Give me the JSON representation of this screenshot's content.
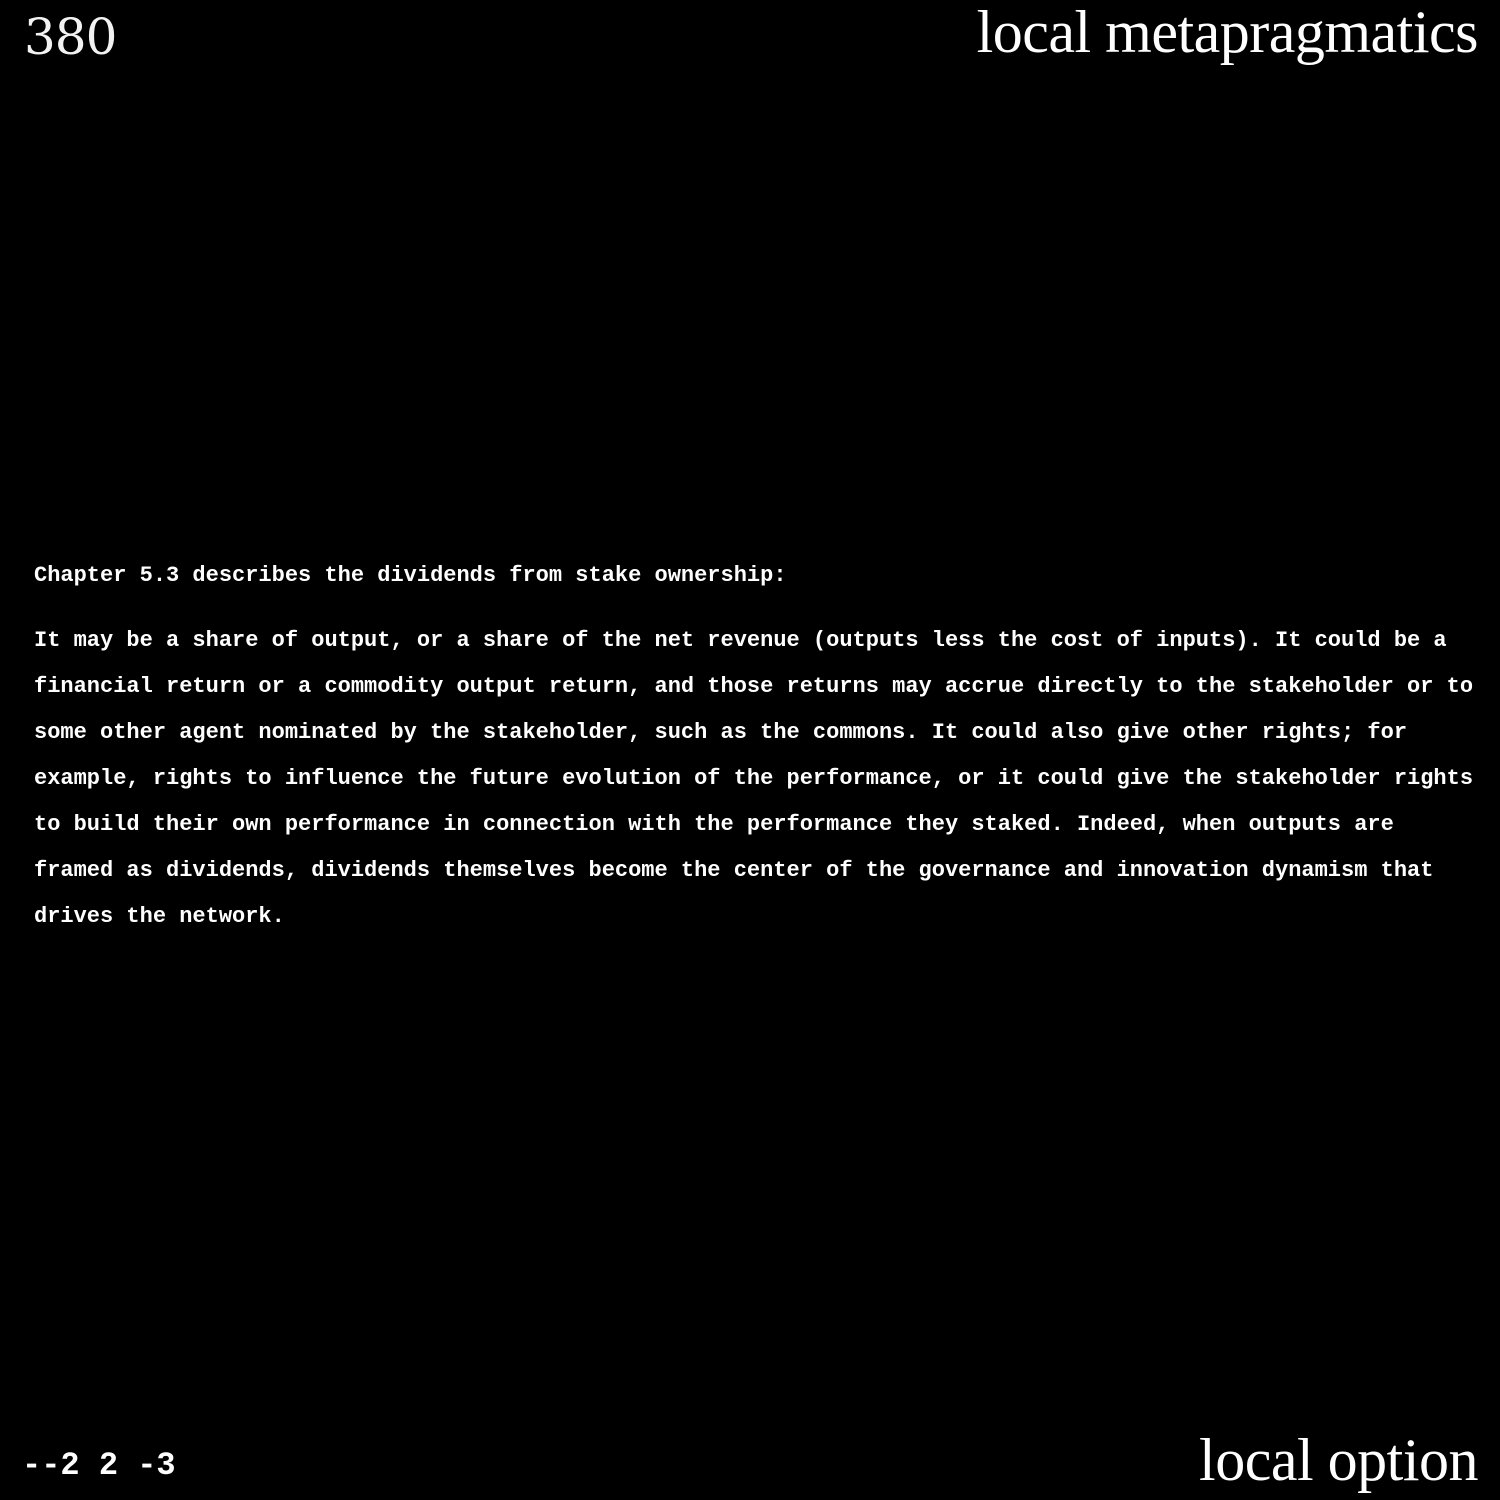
{
  "header": {
    "page_number": "380",
    "running_title": "local metapragmatics"
  },
  "body": {
    "intro": "Chapter 5.3 describes the dividends from stake ownership:",
    "quote": "It may be a share of output, or a share of the net revenue (outputs less the cost of inputs). It could be a financial return or a commodity output return, and those returns may accrue directly to the stakeholder or to some other agent nominated by the stakeholder, such as the commons. It could also give other rights; for example, rights to influence the future evolution of the performance, or it could give the stakeholder rights to build their own performance in connection with the performance they staked. Indeed, when outputs are framed as dividends, dividends themselves become the center of the governance and innovation dynamism that drives the network."
  },
  "footer": {
    "code": "--2 2 -3",
    "title": "local option"
  }
}
